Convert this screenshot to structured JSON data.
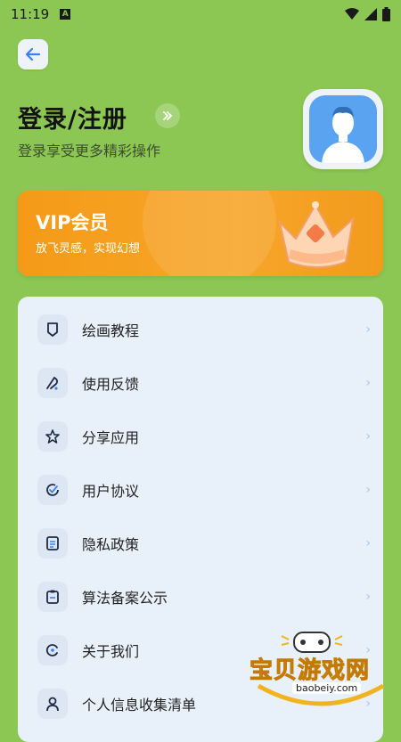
{
  "status_bar": {
    "time": "11:19",
    "badge": "A"
  },
  "header": {
    "title": "登录/注册",
    "subtitle": "登录享受更多精彩操作"
  },
  "vip": {
    "title": "VIP会员",
    "subtitle": "放飞灵感，实现幻想"
  },
  "menu": {
    "items": [
      {
        "label": "绘画教程",
        "icon": "brush-icon"
      },
      {
        "label": "使用反馈",
        "icon": "feedback-icon"
      },
      {
        "label": "分享应用",
        "icon": "star-icon"
      },
      {
        "label": "用户协议",
        "icon": "check-icon"
      },
      {
        "label": "隐私政策",
        "icon": "document-icon"
      },
      {
        "label": "算法备案公示",
        "icon": "clipboard-icon"
      },
      {
        "label": "关于我们",
        "icon": "info-icon"
      },
      {
        "label": "个人信息收集清单",
        "icon": "person-icon"
      }
    ],
    "chevron": "›"
  },
  "watermark": {
    "text": "宝贝游戏网",
    "url": "baobeiy.com"
  },
  "colors": {
    "background": "#8cc653",
    "vip": "#f59a18",
    "menu_card": "#e8f0fa",
    "accent": "#3b82f6"
  }
}
